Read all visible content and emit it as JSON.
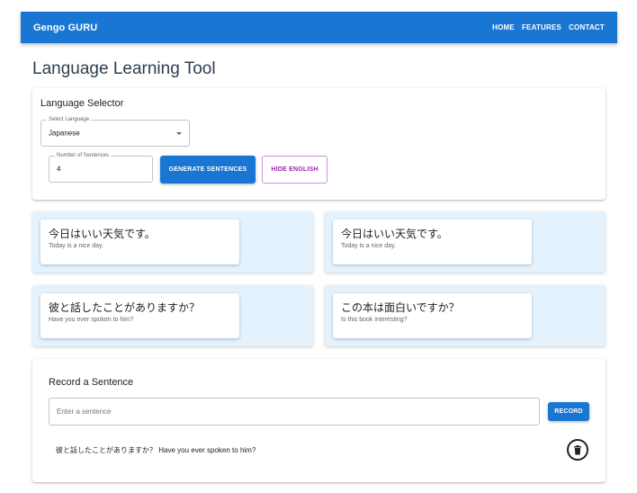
{
  "appbar": {
    "brand": "Gengo GURU",
    "nav": [
      "HOME",
      "FEATURES",
      "CONTACT"
    ]
  },
  "page": {
    "title": "Language Learning Tool"
  },
  "selector": {
    "title": "Language Selector",
    "language_label": "Select Language",
    "language_value": "Japanese",
    "count_label": "Number of Sentences",
    "count_value": "4",
    "generate_label": "GENERATE SENTENCES",
    "hide_label": "HIDE ENGLISH"
  },
  "sentences": [
    {
      "jp": "今日はいい天気です。",
      "en": "Today is a nice day."
    },
    {
      "jp": "今日はいい天気です。",
      "en": "Today is a nice day."
    },
    {
      "jp": "彼と話したことがありますか？",
      "en": "Have you ever spoken to him?"
    },
    {
      "jp": "この本は面白いですか？",
      "en": "Is this book interesting?"
    }
  ],
  "record": {
    "title": "Record a Sentence",
    "placeholder": "Enter a sentence",
    "button_label": "RECORD",
    "recorded_items": [
      "彼と話したことがありますか？ Have you ever spoken to him?"
    ]
  },
  "colors": {
    "primary": "#1976d2",
    "panel_bg": "#e3f2fd",
    "outline_accent": "#9c27b0"
  },
  "icons": {
    "select": "chevron-down-icon",
    "delete": "trash-icon"
  }
}
